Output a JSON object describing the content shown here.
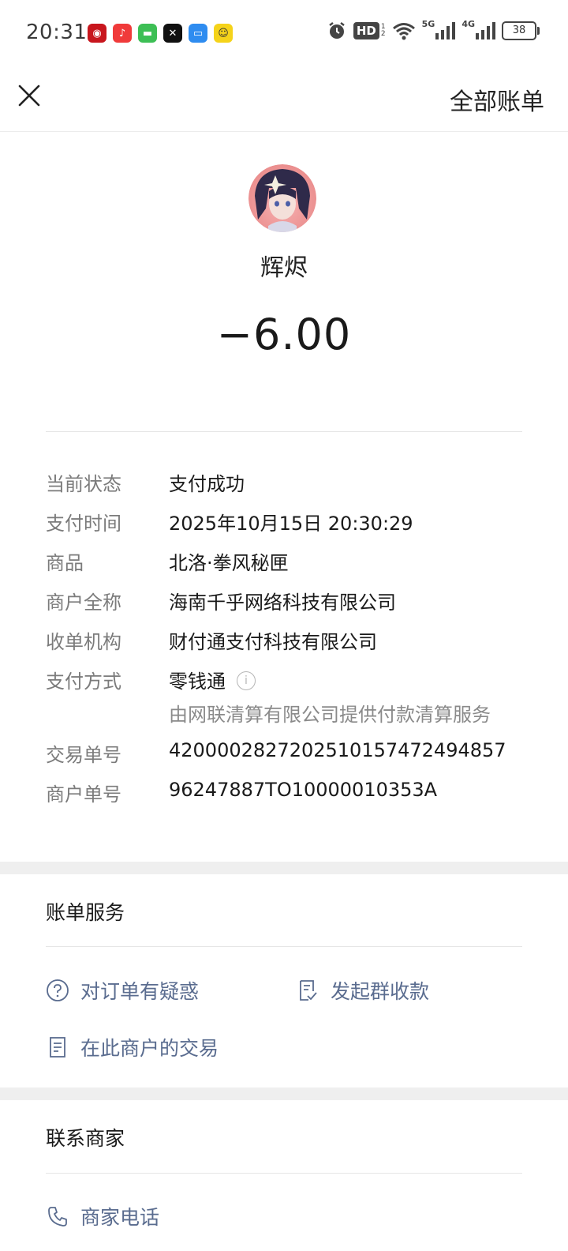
{
  "status_bar": {
    "time": "20:31",
    "hd_label": "HD",
    "hd_sub": [
      "1",
      "2"
    ],
    "net_5g": "5G",
    "net_4g": "4G",
    "battery": "38",
    "app_icons": [
      "bank-app-icon",
      "music-app-icon",
      "messages-app-icon",
      "capcut-app-icon",
      "files-app-icon",
      "yellow-app-icon"
    ]
  },
  "header": {
    "close_icon": "close-icon",
    "all_bills_label": "全部账单"
  },
  "merchant": {
    "name": "辉烬",
    "amount": "−6.00"
  },
  "details": [
    {
      "label": "当前状态",
      "value": "支付成功"
    },
    {
      "label": "支付时间",
      "value": "2025年10月15日 20:30:29"
    },
    {
      "label": "商品",
      "value": "北洛·拳风秘匣"
    },
    {
      "label": "商户全称",
      "value": "海南千乎网络科技有限公司"
    },
    {
      "label": "收单机构",
      "value": "财付通支付科技有限公司"
    },
    {
      "label": "支付方式",
      "value": "零钱通",
      "sub": "由网联清算有限公司提供付款清算服务"
    },
    {
      "label": "交易单号",
      "value": "4200002827202510157472494857"
    },
    {
      "label": "商户单号",
      "value": "96247887TO10000010353A"
    }
  ],
  "bill_service": {
    "title": "账单服务",
    "items": [
      {
        "label": "对订单有疑惑",
        "icon": "question-circle-icon"
      },
      {
        "label": "发起群收款",
        "icon": "group-collect-icon"
      },
      {
        "label": "在此商户的交易",
        "icon": "receipt-icon"
      }
    ]
  },
  "contact": {
    "title": "联系商家",
    "phone_label": "商家电话",
    "phone_icon": "phone-icon"
  }
}
